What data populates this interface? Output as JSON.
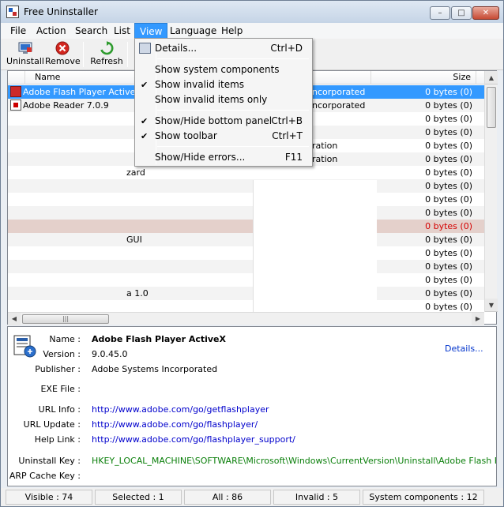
{
  "window": {
    "title": "Free Uninstaller"
  },
  "menu": [
    "File",
    "Action",
    "Search",
    "List",
    "View",
    "Language",
    "Help"
  ],
  "toolbar": {
    "uninstall": "Uninstall",
    "remove": "Remove",
    "refresh": "Refresh"
  },
  "list": {
    "columns": {
      "name": "Name",
      "size": "Size"
    },
    "rows": [
      {
        "name": "Adobe Flash Player ActiveX",
        "publisher_fragment": "ncorporated",
        "size": "0 bytes (0)",
        "state": "selected"
      },
      {
        "name": "Adobe Reader 7.0.9",
        "publisher_fragment": "ncorporated",
        "size": "0 bytes (0)",
        "state": "alt"
      },
      {
        "name": "",
        "publisher_fragment": "",
        "size": "0 bytes (0)",
        "state": "normal"
      },
      {
        "name": "",
        "publisher_fragment": "",
        "size": "0 bytes (0)",
        "state": "alt"
      },
      {
        "name": "",
        "publisher_fragment": "ration",
        "size": "0 bytes (0)",
        "state": "normal"
      },
      {
        "name": "",
        "publisher_fragment": "ration",
        "size": "0 bytes (0)",
        "state": "alt"
      },
      {
        "name": "zard",
        "publisher_fragment": "",
        "size": "0 bytes (0)",
        "state": "normal"
      },
      {
        "name": "",
        "publisher_fragment": "",
        "size": "0 bytes (0)",
        "state": "alt"
      },
      {
        "name": "",
        "publisher_fragment": "",
        "size": "0 bytes (0)",
        "state": "normal"
      },
      {
        "name": "",
        "publisher_fragment": "",
        "size": "0 bytes (0)",
        "state": "alt"
      },
      {
        "name": "",
        "publisher_fragment": "",
        "size": "0 bytes (0)",
        "state": "invalid"
      },
      {
        "name": "GUI",
        "publisher_fragment": "",
        "size": "0 bytes (0)",
        "state": "alt"
      },
      {
        "name": "",
        "publisher_fragment": "",
        "size": "0 bytes (0)",
        "state": "normal"
      },
      {
        "name": "",
        "publisher_fragment": "",
        "size": "0 bytes (0)",
        "state": "alt"
      },
      {
        "name": "",
        "publisher_fragment": "",
        "size": "0 bytes (0)",
        "state": "normal"
      },
      {
        "name": "a 1.0",
        "publisher_fragment": "",
        "size": "0 bytes (0)",
        "state": "alt"
      },
      {
        "name": "",
        "publisher_fragment": "",
        "size": "0 bytes (0)",
        "state": "normal"
      }
    ]
  },
  "view_menu": [
    {
      "label": "Details...",
      "shortcut": "Ctrl+D",
      "checked": false,
      "icon": "details-icon"
    },
    {
      "label": "Show system components",
      "shortcut": "",
      "checked": false
    },
    {
      "label": "Show invalid items",
      "shortcut": "",
      "checked": true
    },
    {
      "label": "Show invalid items only",
      "shortcut": "",
      "checked": false
    },
    {
      "label": "Show/Hide bottom panel",
      "shortcut": "Ctrl+B",
      "checked": true
    },
    {
      "label": "Show toolbar",
      "shortcut": "Ctrl+T",
      "checked": true
    },
    {
      "label": "Show/Hide errors...",
      "shortcut": "F11",
      "checked": false
    }
  ],
  "details": {
    "link": "Details...",
    "fields": [
      {
        "label": "Name :",
        "value": "Adobe Flash Player ActiveX",
        "kind": "name"
      },
      {
        "label": "Version :",
        "value": "9.0.45.0",
        "kind": "text"
      },
      {
        "label": "Publisher :",
        "value": "Adobe Systems Incorporated",
        "kind": "text"
      },
      {
        "label": "EXE File :",
        "value": "",
        "kind": "text"
      },
      {
        "label": "URL Info :",
        "value": "http://www.adobe.com/go/getflashplayer",
        "kind": "link"
      },
      {
        "label": "URL Update :",
        "value": "http://www.adobe.com/go/flashplayer/",
        "kind": "link"
      },
      {
        "label": "Help Link :",
        "value": "http://www.adobe.com/go/flashplayer_support/",
        "kind": "link"
      },
      {
        "label": "Uninstall Key :",
        "value": "HKEY_LOCAL_MACHINE\\SOFTWARE\\Microsoft\\Windows\\CurrentVersion\\Uninstall\\Adobe Flash Player ActiveX",
        "kind": "key"
      },
      {
        "label": "ARP Cache Key :",
        "value": "",
        "kind": "text"
      }
    ]
  },
  "status": {
    "visible": "Visible : 74",
    "selected": "Selected : 1",
    "all": "All : 86",
    "invalid": "Invalid : 5",
    "system": "System components : 12"
  },
  "colors": {
    "selection": "#3399ff",
    "invalid_row": "#e4d0cb",
    "invalid_text": "#d40000",
    "link": "#0000cc",
    "key": "#0a7f0a"
  }
}
